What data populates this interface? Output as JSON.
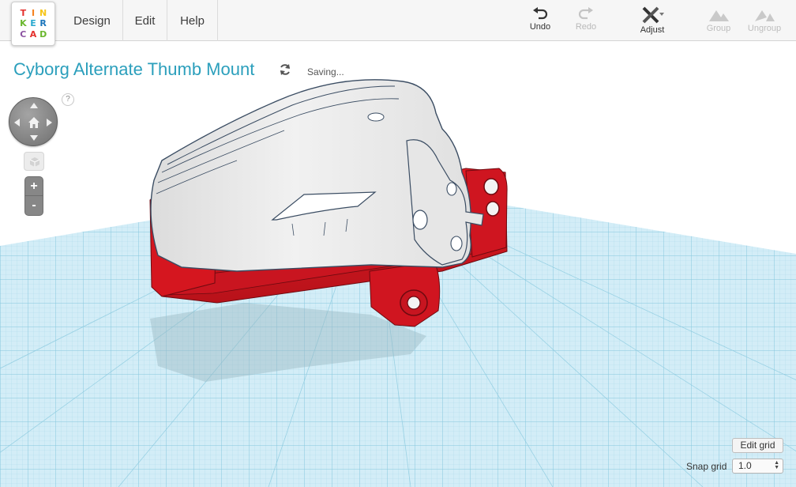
{
  "app": {
    "logo_letters": [
      "T",
      "I",
      "N",
      "K",
      "E",
      "R",
      "C",
      "A",
      "D"
    ],
    "logo_colors": [
      "#e4302d",
      "#f58220",
      "#f6c51a",
      "#6ab72d",
      "#2aa9cf",
      "#1a75bb",
      "#8b52a1",
      "#e4302d",
      "#6ab72d"
    ]
  },
  "menu": {
    "design": "Design",
    "edit": "Edit",
    "help": "Help"
  },
  "toolbar": {
    "undo": "Undo",
    "redo": "Redo",
    "adjust": "Adjust",
    "group": "Group",
    "ungroup": "Ungroup"
  },
  "design": {
    "title": "Cyborg Alternate Thumb Mount",
    "status": "Saving..."
  },
  "view_controls": {
    "help": "?",
    "zoom_in": "+",
    "zoom_out": "-"
  },
  "grid_controls": {
    "edit_grid": "Edit grid",
    "snap_grid_label": "Snap grid",
    "snap_grid_value": "1.0"
  },
  "colors": {
    "accent": "#2b9fbc",
    "workplane": "#cfeaf4",
    "grid_line": "#8ccbe0",
    "part_red": "#d4161f",
    "part_white": "#eaeaea"
  }
}
